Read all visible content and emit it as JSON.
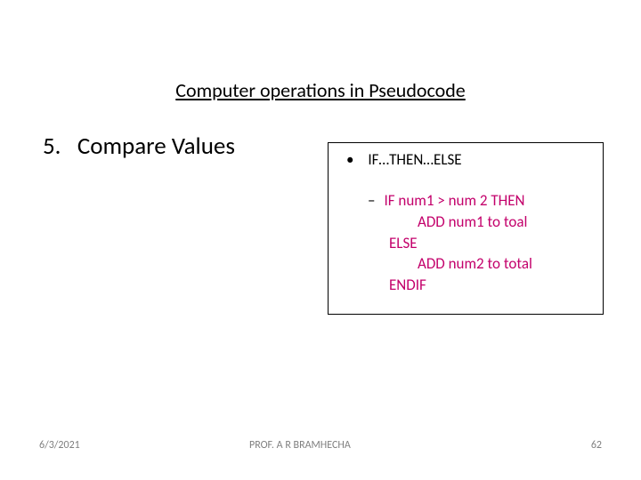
{
  "title": "Computer operations in Pseudocode",
  "section": {
    "number": "5.",
    "label": "Compare Values"
  },
  "box": {
    "bullet_label": "IF…THEN…ELSE",
    "code": {
      "line1": "IF num1 > num 2 THEN",
      "line2": "ADD num1 to toal",
      "line3": "ELSE",
      "line4": "ADD num2 to total",
      "line5": "ENDIF"
    }
  },
  "footer": {
    "date": "6/3/2021",
    "author": "PROF. A R BRAMHECHA",
    "page": "62"
  }
}
